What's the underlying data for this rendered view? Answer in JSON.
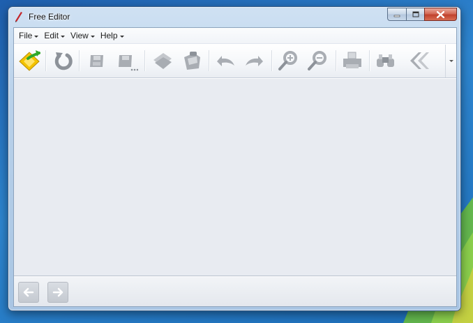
{
  "window": {
    "title": "Free Editor"
  },
  "menu": {
    "items": [
      {
        "label": "File"
      },
      {
        "label": "Edit"
      },
      {
        "label": "View"
      },
      {
        "label": "Help"
      }
    ]
  },
  "toolbar": {
    "buttons": [
      {
        "icon": "new-document-icon",
        "enabled": true
      },
      {
        "icon": "reload-icon",
        "enabled": true
      },
      {
        "icon": "save-icon",
        "enabled": false
      },
      {
        "icon": "save-as-icon",
        "enabled": false
      },
      {
        "icon": "copy-icon",
        "enabled": false
      },
      {
        "icon": "paste-icon",
        "enabled": false
      },
      {
        "icon": "undo-icon",
        "enabled": false
      },
      {
        "icon": "redo-icon",
        "enabled": false
      },
      {
        "icon": "zoom-in-icon",
        "enabled": false
      },
      {
        "icon": "zoom-out-icon",
        "enabled": false
      },
      {
        "icon": "print-icon",
        "enabled": false
      },
      {
        "icon": "find-icon",
        "enabled": false
      },
      {
        "icon": "go-back-icon",
        "enabled": false
      }
    ]
  },
  "navigation": {
    "back_icon": "arrow-left-icon",
    "forward_icon": "arrow-right-icon",
    "enabled": false
  },
  "colors": {
    "accent_green": "#2fa82a",
    "accent_yellow": "#f3c300",
    "disabled_gray": "#a9adb3",
    "editor_background": "#e8ebf1"
  }
}
